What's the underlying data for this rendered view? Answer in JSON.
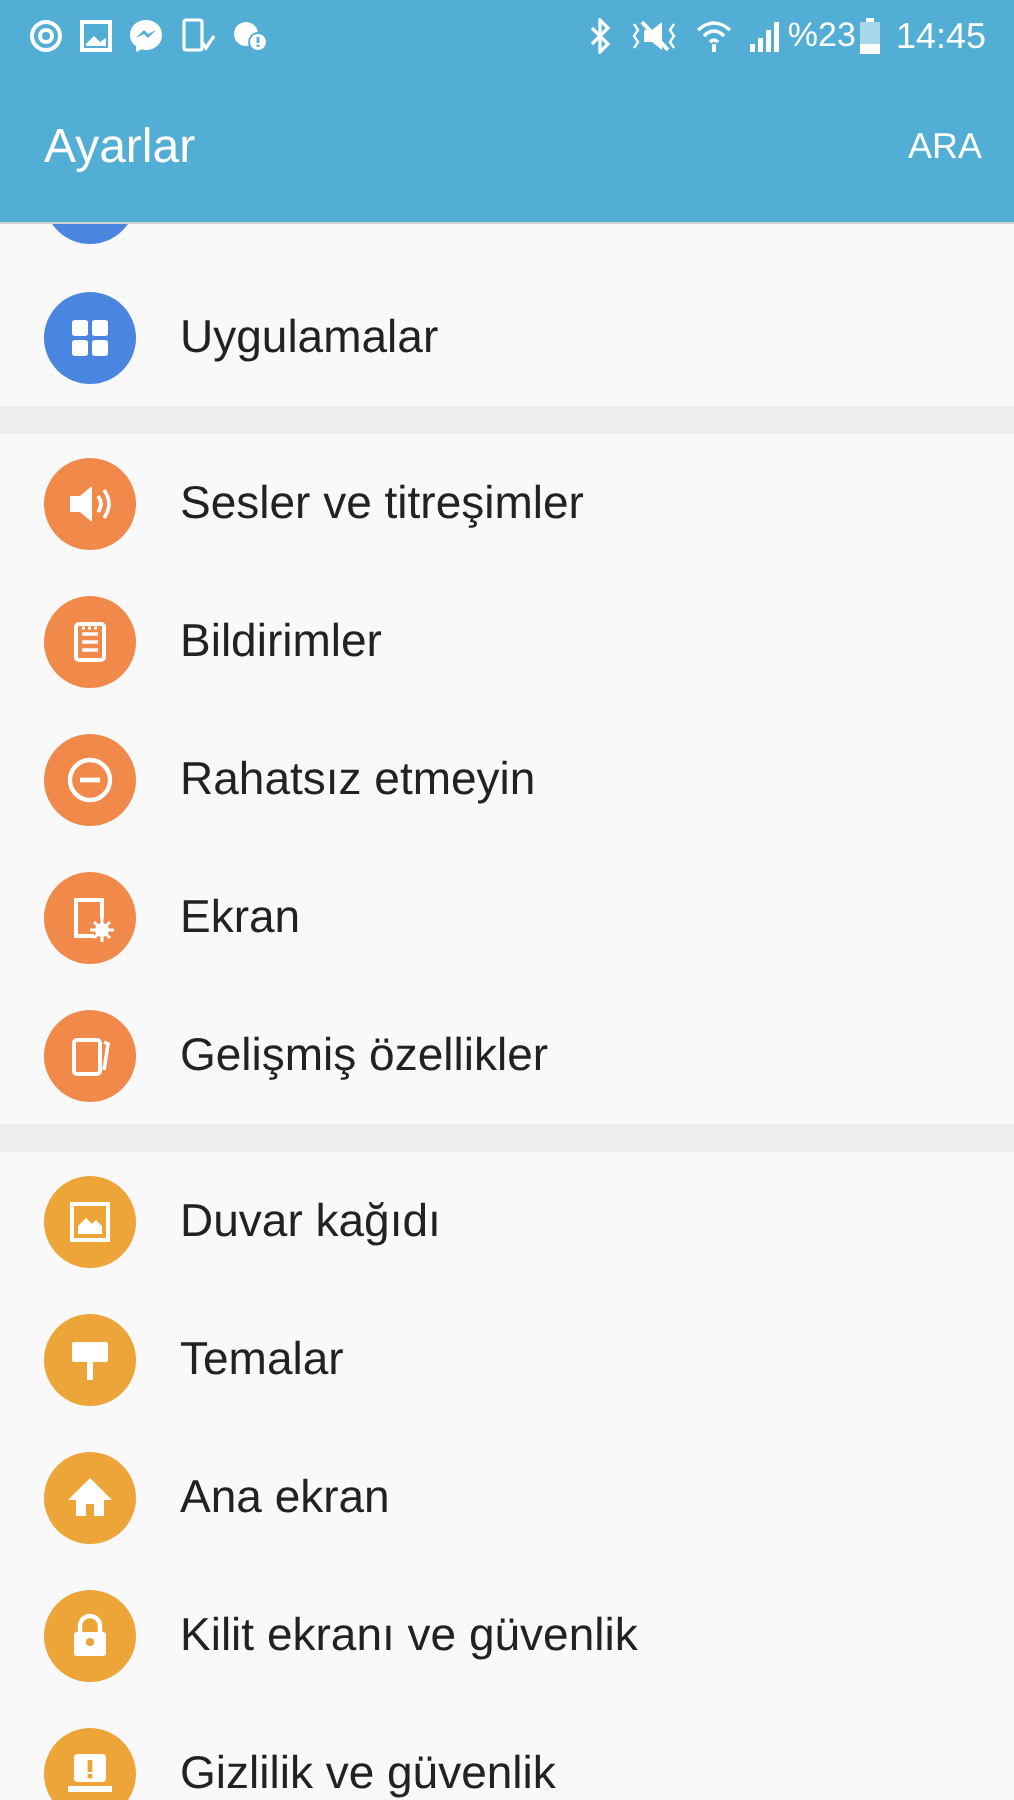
{
  "status_bar": {
    "battery": "%23",
    "time": "14:45"
  },
  "header": {
    "title": "Ayarlar",
    "action": "ARA"
  },
  "groups": [
    {
      "partial_top": true,
      "items": [
        {
          "kind": "apps",
          "label": "Uygulamalar",
          "color": "#4a86e0"
        }
      ]
    },
    {
      "items": [
        {
          "kind": "sound",
          "label": "Sesler ve titreşimler",
          "color": "#f0894a"
        },
        {
          "kind": "notifications",
          "label": "Bildirimler",
          "color": "#f0894a"
        },
        {
          "kind": "dnd",
          "label": "Rahatsız etmeyin",
          "color": "#f0894a"
        },
        {
          "kind": "display",
          "label": "Ekran",
          "color": "#f0894a"
        },
        {
          "kind": "advanced",
          "label": "Gelişmiş özellikler",
          "color": "#f0894a"
        }
      ]
    },
    {
      "items": [
        {
          "kind": "wallpaper",
          "label": "Duvar kağıdı",
          "color": "#eda53a"
        },
        {
          "kind": "themes",
          "label": "Temalar",
          "color": "#eda53a"
        },
        {
          "kind": "home",
          "label": "Ana ekran",
          "color": "#eda53a"
        },
        {
          "kind": "lock",
          "label": "Kilit ekranı ve güvenlik",
          "color": "#eda53a"
        },
        {
          "kind": "privacy",
          "label": "Gizlilik ve güvenlik",
          "color": "#eda53a"
        }
      ]
    }
  ]
}
